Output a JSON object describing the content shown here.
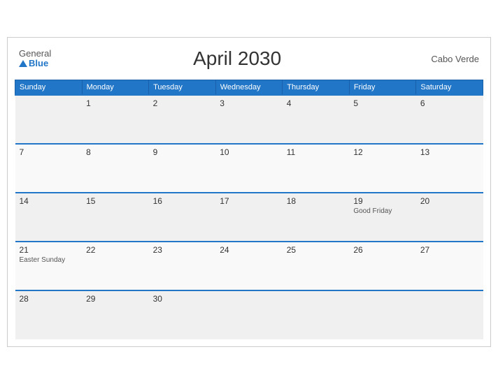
{
  "header": {
    "title": "April 2030",
    "region": "Cabo Verde",
    "logo_general": "General",
    "logo_blue": "Blue"
  },
  "weekdays": [
    "Sunday",
    "Monday",
    "Tuesday",
    "Wednesday",
    "Thursday",
    "Friday",
    "Saturday"
  ],
  "weeks": [
    [
      {
        "day": "",
        "event": ""
      },
      {
        "day": "1",
        "event": ""
      },
      {
        "day": "2",
        "event": ""
      },
      {
        "day": "3",
        "event": ""
      },
      {
        "day": "4",
        "event": ""
      },
      {
        "day": "5",
        "event": ""
      },
      {
        "day": "6",
        "event": ""
      }
    ],
    [
      {
        "day": "7",
        "event": ""
      },
      {
        "day": "8",
        "event": ""
      },
      {
        "day": "9",
        "event": ""
      },
      {
        "day": "10",
        "event": ""
      },
      {
        "day": "11",
        "event": ""
      },
      {
        "day": "12",
        "event": ""
      },
      {
        "day": "13",
        "event": ""
      }
    ],
    [
      {
        "day": "14",
        "event": ""
      },
      {
        "day": "15",
        "event": ""
      },
      {
        "day": "16",
        "event": ""
      },
      {
        "day": "17",
        "event": ""
      },
      {
        "day": "18",
        "event": ""
      },
      {
        "day": "19",
        "event": "Good Friday"
      },
      {
        "day": "20",
        "event": ""
      }
    ],
    [
      {
        "day": "21",
        "event": "Easter Sunday"
      },
      {
        "day": "22",
        "event": ""
      },
      {
        "day": "23",
        "event": ""
      },
      {
        "day": "24",
        "event": ""
      },
      {
        "day": "25",
        "event": ""
      },
      {
        "day": "26",
        "event": ""
      },
      {
        "day": "27",
        "event": ""
      }
    ],
    [
      {
        "day": "28",
        "event": ""
      },
      {
        "day": "29",
        "event": ""
      },
      {
        "day": "30",
        "event": ""
      },
      {
        "day": "",
        "event": ""
      },
      {
        "day": "",
        "event": ""
      },
      {
        "day": "",
        "event": ""
      },
      {
        "day": "",
        "event": ""
      }
    ]
  ]
}
